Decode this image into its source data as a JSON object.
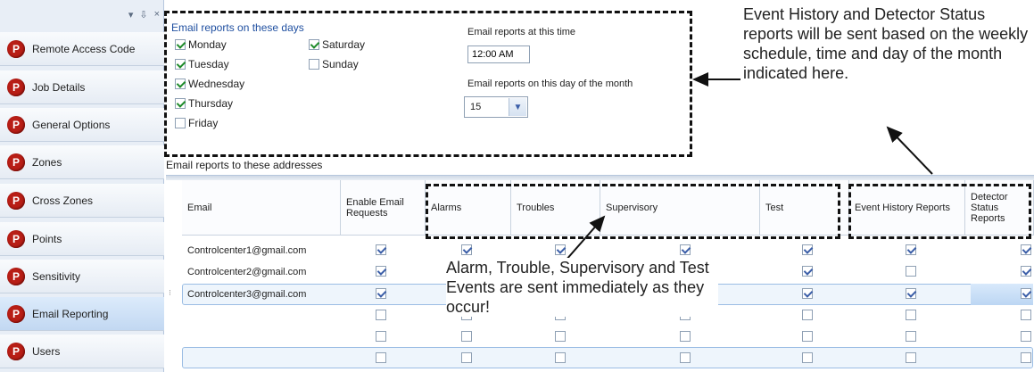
{
  "sidebar": {
    "toolbar": {
      "pin": "⇩",
      "close": "×"
    },
    "items": [
      {
        "label": "Remote Access Code",
        "active": false
      },
      {
        "label": "Job Details",
        "active": false
      },
      {
        "label": "General Options",
        "active": false
      },
      {
        "label": "Zones",
        "active": false
      },
      {
        "label": "Cross Zones",
        "active": false
      },
      {
        "label": "Points",
        "active": false
      },
      {
        "label": "Sensitivity",
        "active": false
      },
      {
        "label": "Email Reporting",
        "active": true
      },
      {
        "label": "Users",
        "active": false
      }
    ],
    "icon_letter": "P"
  },
  "schedule": {
    "days_title": "Email reports on these days",
    "days": [
      {
        "label": "Monday",
        "checked": true
      },
      {
        "label": "Tuesday",
        "checked": true
      },
      {
        "label": "Wednesday",
        "checked": true
      },
      {
        "label": "Thursday",
        "checked": true
      },
      {
        "label": "Friday",
        "checked": false
      },
      {
        "label": "Saturday",
        "checked": true
      },
      {
        "label": "Sunday",
        "checked": false
      }
    ],
    "time_label": "Email reports at this time",
    "time_value": "12:00 AM",
    "month_label": "Email reports on this day of the month",
    "month_value": "15"
  },
  "addresses_label": "Email reports to these addresses",
  "grid": {
    "columns": [
      {
        "label": "Email"
      },
      {
        "label": "Enable Email Requests"
      },
      {
        "label": "Alarms"
      },
      {
        "label": "Troubles"
      },
      {
        "label": "Supervisory"
      },
      {
        "label": "Test"
      },
      {
        "label": "Event History Reports"
      },
      {
        "label": "Detector Status Reports"
      }
    ],
    "rows": [
      {
        "email": "Controlcenter1@gmail.com",
        "checks": [
          true,
          true,
          true,
          true,
          true,
          true,
          true
        ]
      },
      {
        "email": "Controlcenter2@gmail.com",
        "checks": [
          true,
          false,
          false,
          false,
          true,
          false,
          true
        ]
      },
      {
        "email": "Controlcenter3@gmail.com",
        "checks": [
          true,
          false,
          false,
          false,
          true,
          true,
          true
        ]
      },
      {
        "email": "",
        "checks": [
          false,
          false,
          false,
          false,
          false,
          false,
          false
        ]
      },
      {
        "email": "",
        "checks": [
          false,
          false,
          false,
          false,
          false,
          false,
          false
        ]
      },
      {
        "email": "",
        "checks": [
          false,
          false,
          false,
          false,
          false,
          false,
          false
        ]
      }
    ]
  },
  "annotations": {
    "top": "Event History and Detector Status reports will be sent based on the weekly schedule, time and day of the month indicated here.",
    "bottom": "Alarm, Trouble, Supervisory and Test Events are sent immediately as they occur!"
  },
  "colors": {
    "accent": "#1f4fa0",
    "p_icon": "#b81e16",
    "check": "#1e8b2a"
  }
}
